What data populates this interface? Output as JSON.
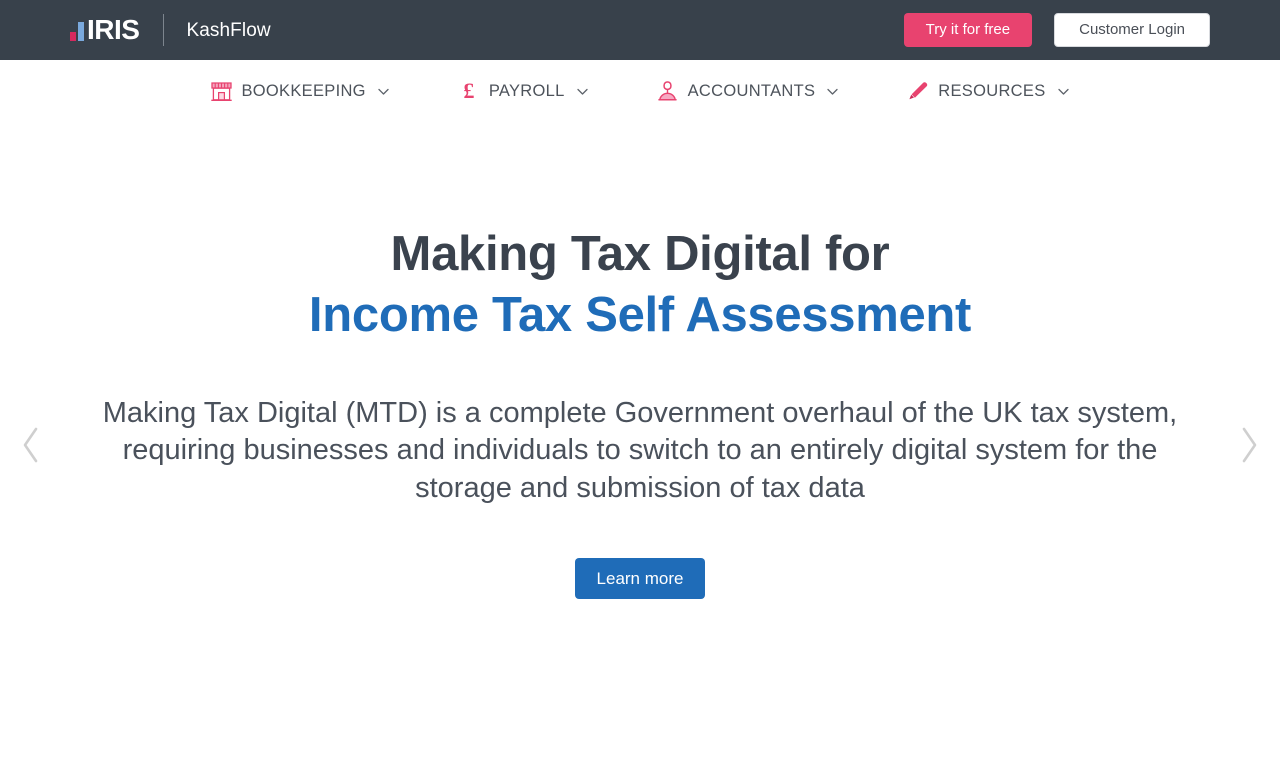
{
  "topbar": {
    "logo_primary": "IRIS",
    "logo_secondary": "KashFlow",
    "try_free_label": "Try it for free",
    "customer_login_label": "Customer Login",
    "background_color": "#38414b",
    "try_free_color": "#e8436f",
    "logo_bar_red": "#d6295e",
    "logo_bar_blue": "#7aa9dd"
  },
  "nav": {
    "accent_color": "#e8436f",
    "items": [
      {
        "label": "BOOKKEEPING",
        "icon": "shop-icon",
        "caret": "chevron-down-icon"
      },
      {
        "label": "PAYROLL",
        "icon": "pound-icon",
        "caret": "chevron-down-icon"
      },
      {
        "label": "ACCOUNTANTS",
        "icon": "accountant-person-icon",
        "caret": "chevron-down-icon"
      },
      {
        "label": "RESOURCES",
        "icon": "pencil-icon",
        "caret": "chevron-down-icon"
      }
    ]
  },
  "hero": {
    "title_line1": "Making Tax Digital for",
    "title_line2": "Income Tax Self Assessment",
    "title_color": "#3a424d",
    "title_accent_color": "#1f6cb8",
    "description": "Making Tax Digital (MTD) is a complete Government overhaul of the UK tax system, requiring businesses and individuals to switch to an entirely digital system for the storage and submission of tax data",
    "cta_label": "Learn more",
    "cta_color": "#1f6cb8",
    "prev_arrow": "chevron-left-icon",
    "next_arrow": "chevron-right-icon",
    "arrow_color": "#cfcfcf"
  }
}
